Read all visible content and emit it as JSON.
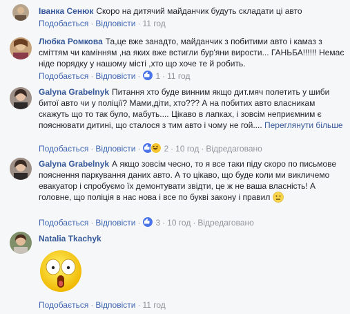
{
  "comments": [
    {
      "author": "Іванка Сенюк",
      "text": "Скоро на дитячий майданчик будуть складати ці авто",
      "like_label": "Подобається",
      "reply_label": "Відповісти",
      "time": "11 год"
    },
    {
      "author": "Любка Ромкова",
      "text": "Та,це вже занадто, майданчик з побитими авто і камаз з сміттям чи камінням ,на яких вже встигли бур'яни вирости... ГАНЬБА!!!!!! Немає ніде порядку у нашому місті ,хто що хоче те й робить.",
      "like_label": "Подобається",
      "reply_label": "Відповісти",
      "reaction_count": "1",
      "time": "11 год"
    },
    {
      "author": "Galyna Grabelnyk",
      "text": "Питання хто буде винним якщо дит.мяч полетить у шиби битої авто чи у поліції? Мами,діти, хто??? А на побитих авто власникам скажуть що то так було, мабуть.... Цікаво в лапках, і зовсім неприємним є пояснювати дитині, що сталося з тим авто і чому не гой....",
      "see_more": "Переглянути більше",
      "like_label": "Подобається",
      "reply_label": "Відповісти",
      "reaction_count": "2",
      "time": "10 год",
      "edited": "Відредаговано"
    },
    {
      "author": "Galyna Grabelnyk",
      "text": "А якщо зовсім чесно, то я все таки піду скоро по письмове пояснення паркування даних авто. А то цікаво, що буде коли ми викличемо евакуатор і спробуємо їх демонтувати звідти, це ж не ваша власність! А головне, що поліція в нас нова і все по букві закону і правил",
      "like_label": "Подобається",
      "reply_label": "Відповісти",
      "reaction_count": "3",
      "time": "10 год",
      "edited": "Відредаговано"
    },
    {
      "author": "Natalia Tkachyk",
      "like_label": "Подобається",
      "reply_label": "Відповісти",
      "time": "11 год"
    }
  ],
  "colors": {
    "author": "#365899",
    "link": "#4267b2",
    "meta": "#90949c",
    "background": "#f6f7f9"
  },
  "icons": [
    "avatar",
    "like-reaction-icon",
    "haha-reaction-icon",
    "neutral-emoji-icon",
    "shocked-sticker-icon"
  ]
}
